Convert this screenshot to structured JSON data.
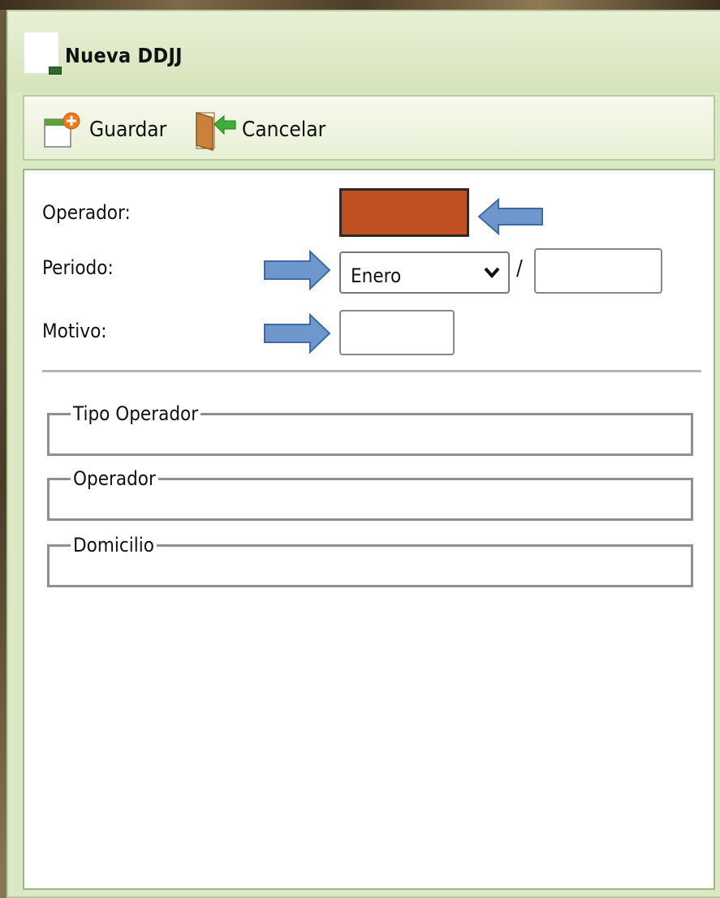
{
  "window": {
    "title": "Nueva DDJJ"
  },
  "toolbar": {
    "save_label": "Guardar",
    "cancel_label": "Cancelar",
    "save_icon": "calendar-add-icon",
    "cancel_icon": "exit-door-icon"
  },
  "form": {
    "operador_label": "Operador:",
    "operador_color": "#c05022",
    "periodo_label": "Periodo:",
    "periodo_month": "Enero",
    "periodo_separator": "/",
    "periodo_year": "",
    "motivo_label": "Motivo:",
    "motivo_value": ""
  },
  "groups": {
    "tipo_operador": "Tipo Operador",
    "operador": "Operador",
    "domicilio": "Domicilio"
  },
  "colors": {
    "accent_arrow": "#6e97cd",
    "panel_green": "#dbe8c4"
  }
}
